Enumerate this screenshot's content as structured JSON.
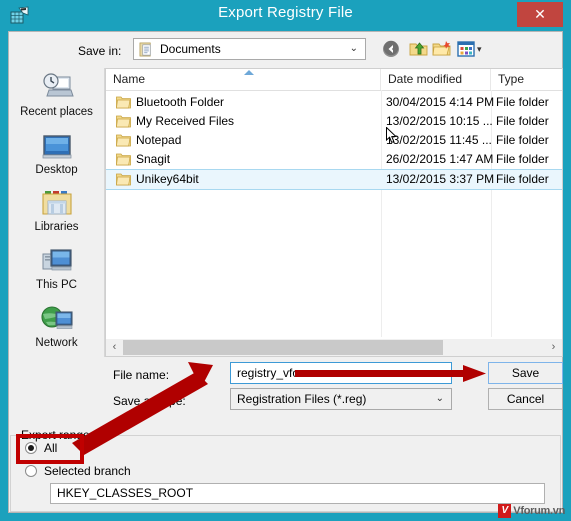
{
  "window": {
    "title": "Export Registry File",
    "title_icon": "registry-editor-icon",
    "close_label": "✕",
    "accent_color": "#1ba1bd",
    "close_color": "#c1453f"
  },
  "toolbar": {
    "save_in_label": "Save in:",
    "save_in_value": "Documents",
    "save_in_icon": "documents-folder-icon",
    "chevron": "⌄",
    "buttons": [
      {
        "name": "back-button",
        "icon": "back-arrow-icon"
      },
      {
        "name": "up-one-level-button",
        "icon": "up-folder-icon"
      },
      {
        "name": "create-new-folder-button",
        "icon": "new-folder-icon"
      },
      {
        "name": "views-button",
        "icon": "views-icon"
      }
    ],
    "views_chevron": "▾"
  },
  "places": [
    {
      "label": "Recent places",
      "icon": "recent-places-icon"
    },
    {
      "label": "Desktop",
      "icon": "desktop-icon"
    },
    {
      "label": "Libraries",
      "icon": "libraries-icon"
    },
    {
      "label": "This PC",
      "icon": "this-pc-icon"
    },
    {
      "label": "Network",
      "icon": "network-icon"
    }
  ],
  "file_list": {
    "columns": [
      "Name",
      "Date modified",
      "Type"
    ],
    "sort_column": "Name",
    "sort_direction": "ascending",
    "rows": [
      {
        "name": "Bluetooth Folder",
        "date": "30/04/2015 4:14 PM",
        "type": "File folder",
        "selected": false
      },
      {
        "name": "My Received Files",
        "date": "13/02/2015 10:15 ...",
        "type": "File folder",
        "selected": false
      },
      {
        "name": "Notepad",
        "date": "13/02/2015 11:45 ...",
        "type": "File folder",
        "selected": false
      },
      {
        "name": "Snagit",
        "date": "26/02/2015 1:47 AM",
        "type": "File folder",
        "selected": false
      },
      {
        "name": "Unikey64bit",
        "date": "13/02/2015 3:37 PM",
        "type": "File folder",
        "selected": true
      }
    ],
    "scroll_left_arrow": "‹",
    "scroll_right_arrow": "›"
  },
  "form": {
    "file_name_label": "File name:",
    "file_name_value": "registry_vforum",
    "file_name_chevron": "⌄",
    "save_as_type_label": "Save as type:",
    "save_as_type_value": "Registration Files (*.reg)",
    "save_as_type_chevron": "⌄",
    "save_button": "Save",
    "cancel_button": "Cancel"
  },
  "export_range": {
    "group_title": "Export range",
    "options": [
      {
        "label": "All",
        "selected": true
      },
      {
        "label": "Selected branch",
        "selected": false
      }
    ],
    "branch_value": "HKEY_CLASSES_ROOT"
  },
  "watermark": {
    "mark": "V",
    "text": "Vforum.vn"
  },
  "annotations": {
    "highlight_color": "#c00000",
    "arrow_to_filename": "red-arrow",
    "arrow_to_save": "red-arrow",
    "box_around_all": "red-rectangle"
  }
}
